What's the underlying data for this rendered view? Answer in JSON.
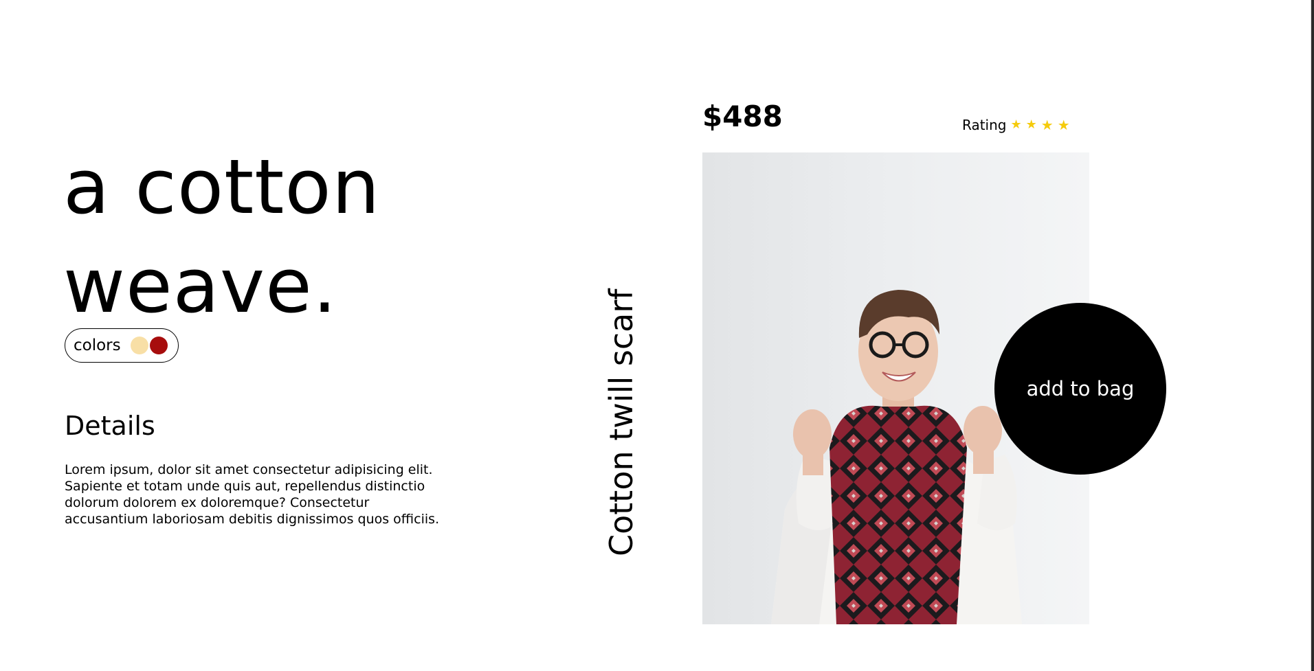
{
  "hero": {
    "title_line1": "a cotton",
    "title_line2": "weave."
  },
  "colors": {
    "label": "colors",
    "swatches": [
      {
        "name": "cream",
        "hex": "#f8dfa6"
      },
      {
        "name": "red",
        "hex": "#a70d0d"
      }
    ]
  },
  "details": {
    "heading": "Details",
    "body": "Lorem ipsum, dolor sit amet consectetur adipisicing elit. Sapiente et totam unde quis aut, repellendus distinctio dolorum dolorem ex doloremque? Consectetur accusantium laboriosam debitis dignissimos quos officiis."
  },
  "product": {
    "name": "Cotton twill scarf",
    "price": "$488",
    "rating_label": "Rating",
    "rating_stars": 4,
    "star_color": "#f5cb0c",
    "photo_icon": "woman-in-scarf-photo",
    "add_to_bag_label": "add to bag"
  }
}
